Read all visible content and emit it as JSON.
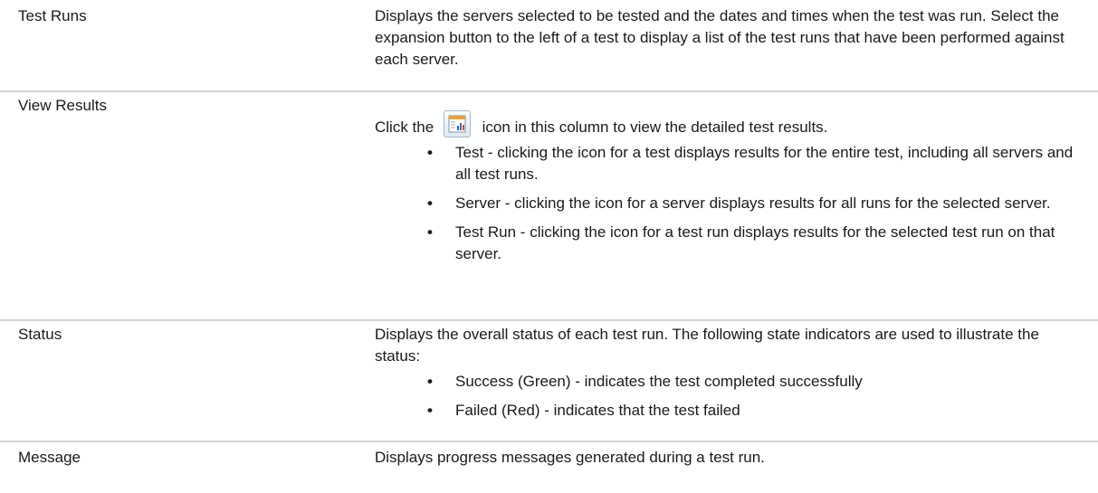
{
  "rows": [
    {
      "term": "Test Runs",
      "description": "Displays the servers selected to be tested and the dates and times when the test was run. Select the expansion button to the left of a test to display a list of the test runs that have been performed against each server."
    },
    {
      "term": "View Results",
      "intro_before_icon": "Click the",
      "icon": "view-results-report-icon",
      "intro_after_icon": "icon in this column to view the detailed test results.",
      "bullets": [
        "Test - clicking the icon for a test displays results for the entire test, including all servers and all test runs.",
        "Server - clicking the icon for a server displays results for all runs for the selected server.",
        "Test Run - clicking the icon for a test run displays results for the selected test run on that server."
      ]
    },
    {
      "term": "Status",
      "description": "Displays the overall status of each test run. The following state indicators are used to illustrate the status:",
      "bullets": [
        "Success (Green) - indicates the test completed successfully",
        "Failed (Red) - indicates that the test failed"
      ]
    },
    {
      "term": "Message",
      "description": "Displays progress messages generated during a test run."
    }
  ],
  "bullet_glyph": "•"
}
